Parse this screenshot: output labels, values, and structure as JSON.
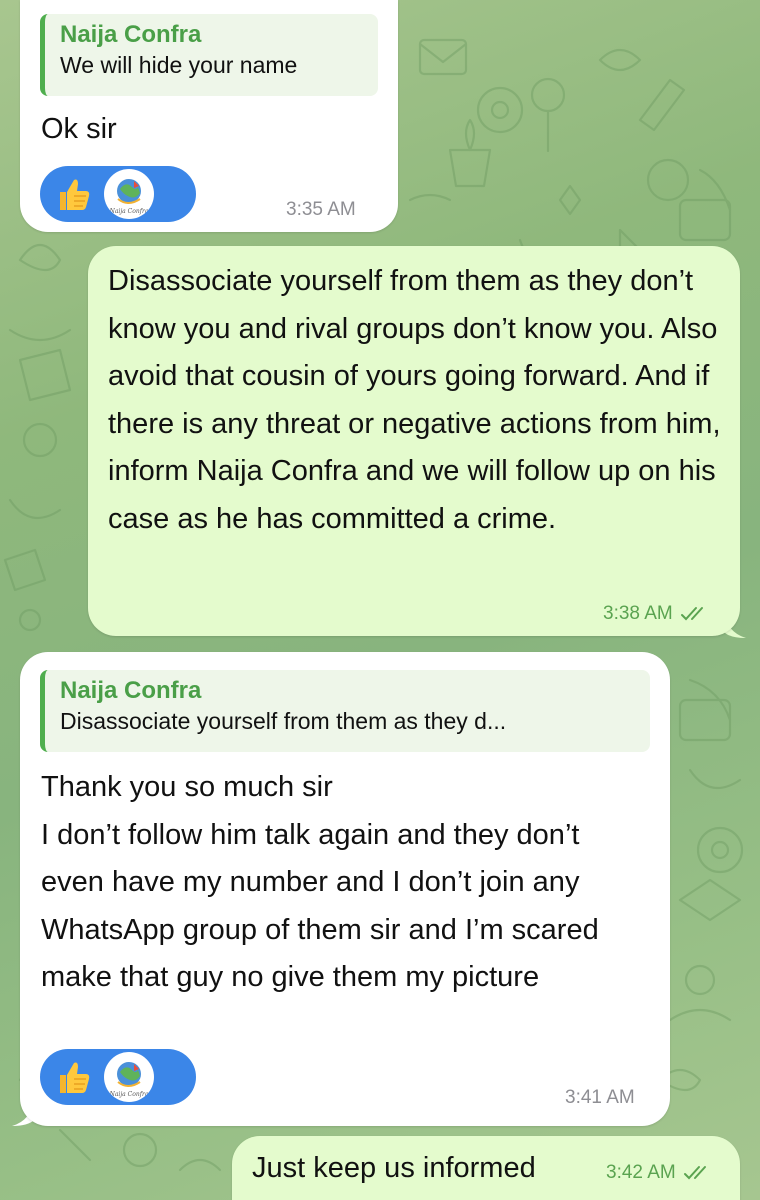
{
  "chat": {
    "messages": [
      {
        "direction": "incoming",
        "reply": {
          "name": "Naija Confra",
          "text": "We will hide your name"
        },
        "text": "Ok sir",
        "reactions": [
          "thumbs-up-icon",
          "naija-confra-avatar"
        ],
        "time": "3:35 AM"
      },
      {
        "direction": "outgoing",
        "text": "Disassociate yourself from them as they don’t know you and rival groups don’t know you. Also avoid that cousin of yours going forward. And if there is any threat or negative actions from him, inform Naija Confra and we will follow up on his case as he has committed a crime.",
        "time": "3:38 AM",
        "status": "read"
      },
      {
        "direction": "incoming",
        "reply": {
          "name": "Naija Confra",
          "text": "Disassociate yourself from them as they d..."
        },
        "text": "Thank you so much sir\nI don’t follow him talk again and they don’t even have my number and I don’t join any WhatsApp group of them sir and I’m scared make that guy no give them my picture",
        "reactions": [
          "thumbs-up-icon",
          "naija-confra-avatar"
        ],
        "time": "3:41 AM"
      },
      {
        "direction": "outgoing",
        "text": "Just keep us informed",
        "time": "3:42 AM",
        "status": "read"
      }
    ]
  },
  "colors": {
    "incoming_bubble": "#ffffff",
    "outgoing_bubble": "#e4fbcd",
    "reply_accent": "#4fae4e",
    "reaction_pill": "#3b86e8",
    "outgoing_time": "#5aa350"
  }
}
